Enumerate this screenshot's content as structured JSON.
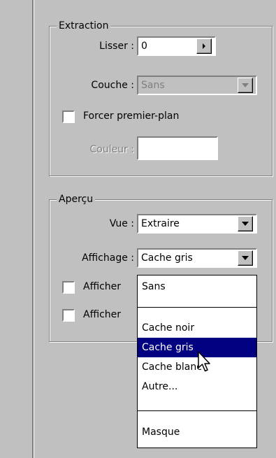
{
  "extraction": {
    "legend": "Extraction",
    "smooth_label": "Lisser :",
    "smooth_value": "0",
    "layer_label": "Couche :",
    "layer_value": "Sans",
    "force_fg_label": "Forcer premier-plan",
    "force_fg_checked": false,
    "color_label": "Couleur :"
  },
  "preview": {
    "legend": "Aperçu",
    "view_label": "Vue :",
    "view_value": "Extraire",
    "display_label": "Affichage :",
    "display_value": "Cache gris",
    "show1_label": "Afficher",
    "show2_label": "Afficher"
  },
  "dropdown": {
    "items": [
      "Sans",
      "Cache noir",
      "Cache gris",
      "Cache blanc",
      "Autre...",
      "Masque"
    ],
    "selected": "Cache gris"
  },
  "icons": {
    "spin": "triangle-right-icon",
    "combo": "triangle-down-icon",
    "cursor": "arrow-cursor-icon"
  },
  "colors": {
    "panel_bg": "#c0c0c0",
    "selection": "#000080",
    "field_bg": "#ffffff"
  }
}
